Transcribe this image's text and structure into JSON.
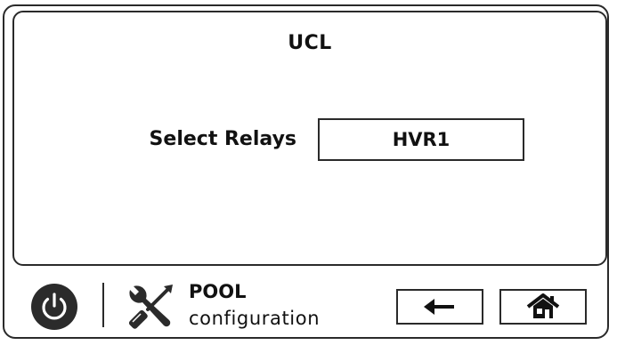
{
  "screen": {
    "title": "UCL"
  },
  "relay_selector": {
    "label": "Select Relays",
    "value": "HVR1"
  },
  "footer": {
    "section_name": "POOL",
    "section_sub": "configuration",
    "icons": {
      "power": "power-icon",
      "tools": "tools-icon",
      "back": "arrow-left-icon",
      "home": "home-icon"
    }
  }
}
